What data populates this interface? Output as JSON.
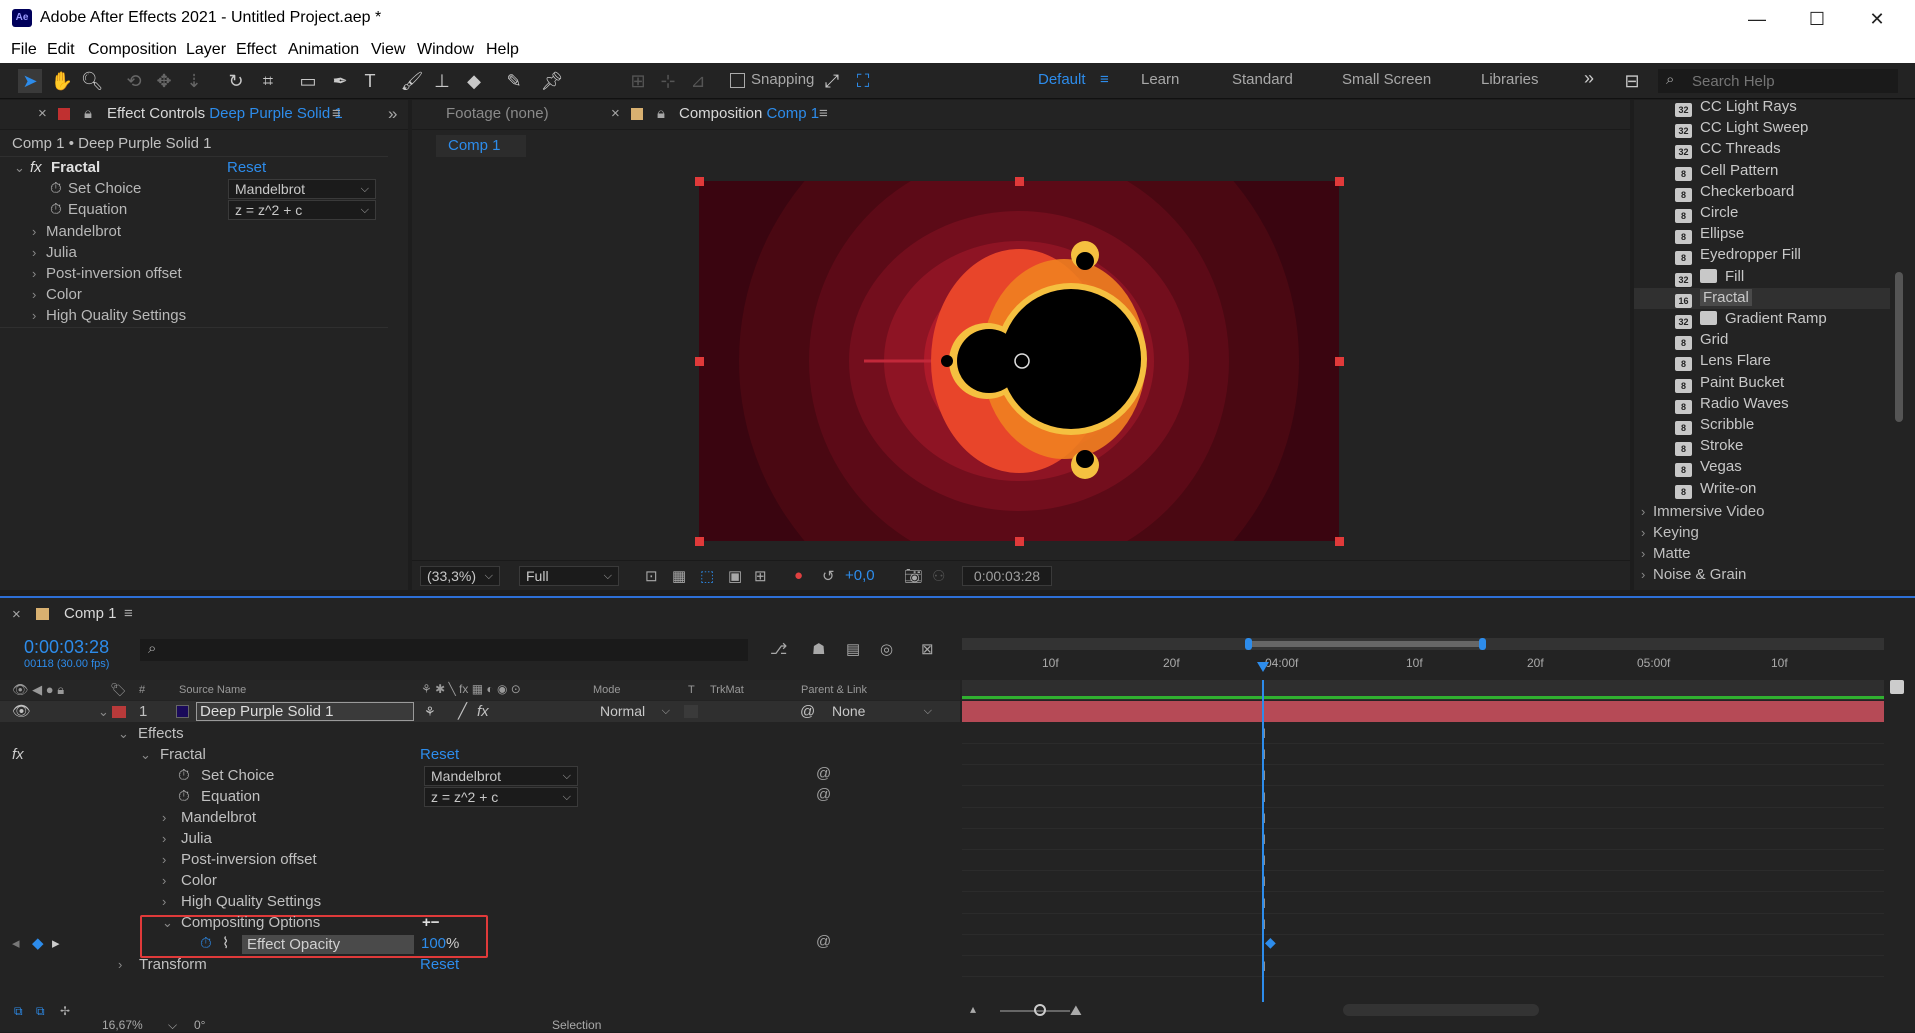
{
  "window": {
    "app_icon": "Ae",
    "title": "Adobe After Effects 2021 - Untitled Project.aep *",
    "minimize": "—",
    "maximize": "☐",
    "close": "✕"
  },
  "menu": [
    "File",
    "Edit",
    "Composition",
    "Layer",
    "Effect",
    "Animation",
    "View",
    "Window",
    "Help"
  ],
  "toolbar": {
    "snapping_label": "Snapping",
    "workspaces": [
      "Default",
      "Learn",
      "Standard",
      "Small Screen",
      "Libraries"
    ],
    "more": "»",
    "search_help_placeholder": "Search Help",
    "accent": "#2d8ceb"
  },
  "effect_controls": {
    "tab_prefix": "Effect Controls",
    "tab_layer": "Deep Purple Solid 1",
    "subtitle": "Comp 1 • Deep Purple Solid 1",
    "fx_label": "fx",
    "effect_name": "Fractal",
    "reset": "Reset",
    "set_choice_label": "Set Choice",
    "set_choice_value": "Mandelbrot",
    "equation_label": "Equation",
    "equation_value": "z = z^2 + c",
    "groups": [
      "Mandelbrot",
      "Julia",
      "Post-inversion offset",
      "Color",
      "High Quality Settings"
    ]
  },
  "viewer": {
    "footage_tab": "Footage  (none)",
    "comp_tab_prefix": "Composition",
    "comp_tab_name": "Comp 1",
    "comp_chip": "Comp 1",
    "zoom": "(33,3%)",
    "resolution": "Full",
    "exposure": "+0,0",
    "timecode": "0:00:03:28"
  },
  "effects_presets": {
    "items": [
      "CC Light Rays",
      "CC Light Sweep",
      "CC Threads",
      "Cell Pattern",
      "Checkerboard",
      "Circle",
      "Ellipse",
      "Eyedropper Fill",
      "Fill",
      "Fractal",
      "Gradient Ramp",
      "Grid",
      "Lens Flare",
      "Paint Bucket",
      "Radio Waves",
      "Scribble",
      "Stroke",
      "Vegas",
      "Write-on"
    ],
    "badges": [
      "32",
      "32",
      "32",
      "8",
      "8",
      "8",
      "8",
      "8",
      "32",
      "16",
      "32",
      "8",
      "8",
      "8",
      "8",
      "8",
      "8",
      "8",
      "8"
    ],
    "selected_index": 9,
    "categories": [
      "Immersive Video",
      "Keying",
      "Matte",
      "Noise & Grain"
    ]
  },
  "timeline": {
    "tab": "Comp 1",
    "timecode": "0:00:03:28",
    "frame_info": "00118 (30.00 fps)",
    "search_placeholder": "",
    "columns": {
      "num": "#",
      "source": "Source Name",
      "mode": "Mode",
      "t": "T",
      "trkmat": "TrkMat",
      "parent": "Parent & Link"
    },
    "layer": {
      "index": "1",
      "name": "Deep Purple Solid 1",
      "mode": "Normal",
      "parent": "None",
      "label_color": "#b83a3a",
      "swatch_color": "#1a0a5a"
    },
    "tree": {
      "effects": "Effects",
      "fx": "fx",
      "fractal": "Fractal",
      "reset": "Reset",
      "set_choice_label": "Set Choice",
      "set_choice_value": "Mandelbrot",
      "equation_label": "Equation",
      "equation_value": "z = z^2 + c",
      "groups": [
        "Mandelbrot",
        "Julia",
        "Post-inversion offset",
        "Color",
        "High Quality Settings"
      ],
      "compositing": "Compositing Options",
      "plusminus": "+−",
      "effect_opacity_label": "Effect Opacity",
      "effect_opacity_value": "100",
      "effect_opacity_unit": "%",
      "transform": "Transform",
      "transform_reset": "Reset"
    },
    "ruler": [
      "10f",
      "20f",
      "04:00f",
      "10f",
      "20f",
      "05:00f",
      "10f"
    ],
    "playhead_color": "#2d8ceb",
    "highlight_color": "#e03a3a"
  },
  "status": {
    "zoom": "16,67%",
    "angle": "0°",
    "mode": "Selection"
  }
}
